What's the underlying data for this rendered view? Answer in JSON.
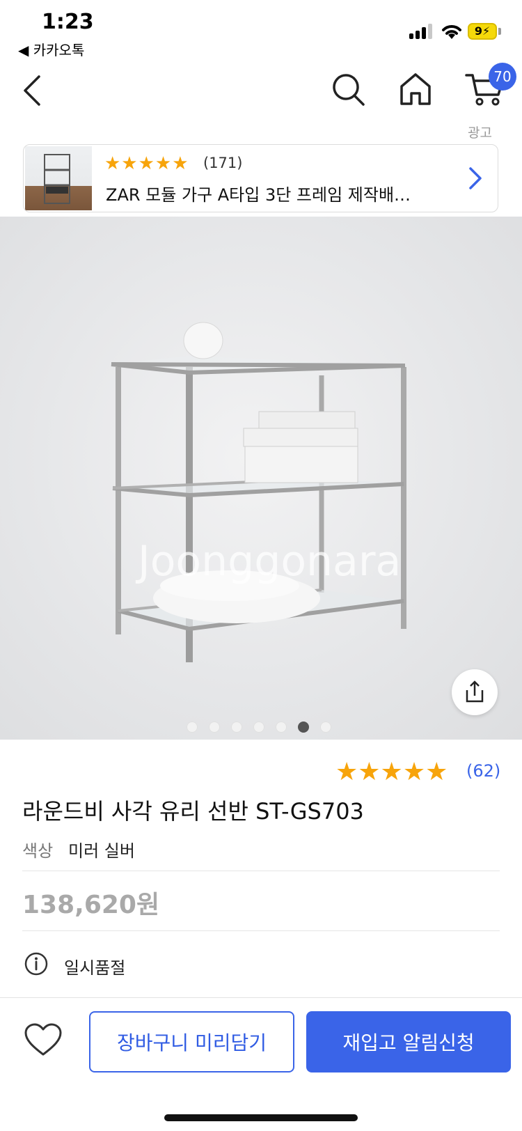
{
  "status_bar": {
    "time": "1:23",
    "back_app": "◀ 카카오톡",
    "battery": "9"
  },
  "header": {
    "cart_count": "70"
  },
  "ad": {
    "label": "광고",
    "stars": "★★★★★",
    "review_count": "(171)",
    "title": "ZAR 모듈 가구 A타입 3단 프레임 제작배…"
  },
  "gallery": {
    "watermark": "Joonggonara",
    "total_images": 7,
    "active_index": 5
  },
  "product": {
    "rating_stars": "★★★★★",
    "review_count": "(62)",
    "title": "라운드비 사각 유리 선반 ST-GS703",
    "option_label": "색상",
    "option_value": "미러 실버",
    "price": "138,620원",
    "stock_status": "일시품절"
  },
  "actions": {
    "add_to_cart": "장바구니 미리담기",
    "restock_alert": "재입고 알림신청"
  },
  "colors": {
    "accent": "#3a64e8",
    "star": "#f7a40b"
  }
}
